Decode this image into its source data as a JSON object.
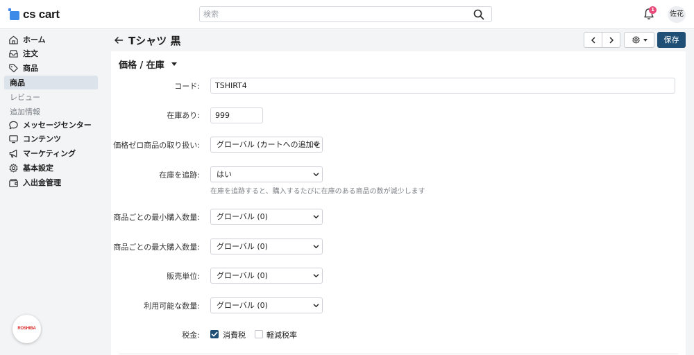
{
  "app": {
    "logo_text": "cs cart",
    "accent_color": "#3d8ae8",
    "primary_button_color": "#1f4f74",
    "notification_badge_color": "#e94c7b"
  },
  "search": {
    "placeholder": "検索",
    "value": ""
  },
  "notifications": {
    "count": "1"
  },
  "user": {
    "avatar_text": "佐花"
  },
  "sidebar": {
    "items": [
      {
        "label": "ホーム",
        "icon": "home-icon"
      },
      {
        "label": "注文",
        "icon": "inbox-icon"
      },
      {
        "label": "商品",
        "icon": "tag-icon"
      },
      {
        "label": "商品",
        "active": true
      },
      {
        "label": "レビュー",
        "sub": true
      },
      {
        "label": "追加情報",
        "sub": true
      },
      {
        "label": "メッセージセンター",
        "icon": "chat-icon"
      },
      {
        "label": "コンテンツ",
        "icon": "monitor-icon"
      },
      {
        "label": "マーケティング",
        "icon": "megaphone-icon"
      },
      {
        "label": "基本設定",
        "icon": "gear-icon"
      },
      {
        "label": "入出金管理",
        "icon": "wallet-icon"
      }
    ],
    "brand_logo_text": "ROSHIBA"
  },
  "header": {
    "title": "Tシャツ 黒",
    "save_label": "保存"
  },
  "section": {
    "title": "価格 / 在庫"
  },
  "form": {
    "code": {
      "label": "コード:",
      "value": "TSHIRT4"
    },
    "in_stock": {
      "label": "在庫あり:",
      "value": "999"
    },
    "zero_price": {
      "label": "価格ゼロ商品の取り扱い:",
      "value": "グローバル (カートへの追加を"
    },
    "track_inventory": {
      "label": "在庫を追跡:",
      "value": "はい",
      "help": "在庫を追跡すると、購入するたびに在庫のある商品の数が減少します"
    },
    "min_qty": {
      "label": "商品ごとの最小購入数量:",
      "value": "グローバル (0)"
    },
    "max_qty": {
      "label": "商品ごとの最大購入数量:",
      "value": "グローバル (0)"
    },
    "sales_unit": {
      "label": "販売単位:",
      "value": "グローバル (0)"
    },
    "available_qty": {
      "label": "利用可能な数量:",
      "value": "グローバル (0)"
    },
    "taxes": {
      "label": "税金:",
      "options": [
        {
          "label": "消費税",
          "checked": true
        },
        {
          "label": "軽減税率",
          "checked": false
        }
      ]
    }
  }
}
